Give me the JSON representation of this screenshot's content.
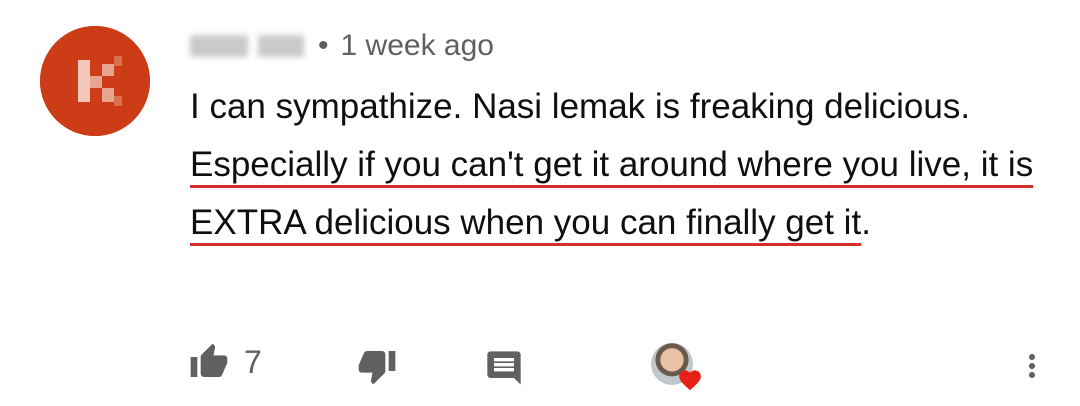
{
  "comment": {
    "author": {
      "initial": "K",
      "avatar_color": "#cc3d17"
    },
    "timestamp": "1 week ago",
    "separator": "•",
    "text_plain_1": "I can sympathize.  Nasi lemak is freaking delicious.  ",
    "text_underlined": "Especially if you can't get it around where you live, it is EXTRA delicious when you can finally get it",
    "text_plain_2": ".",
    "underline_color": "#d32f2f"
  },
  "actions": {
    "like_count": "7",
    "like_icon": "thumbs-up-icon",
    "dislike_icon": "thumbs-down-icon",
    "reply_icon": "comment-icon",
    "creator_heart_icon": "heart-icon",
    "more_icon": "more-vert-icon"
  }
}
